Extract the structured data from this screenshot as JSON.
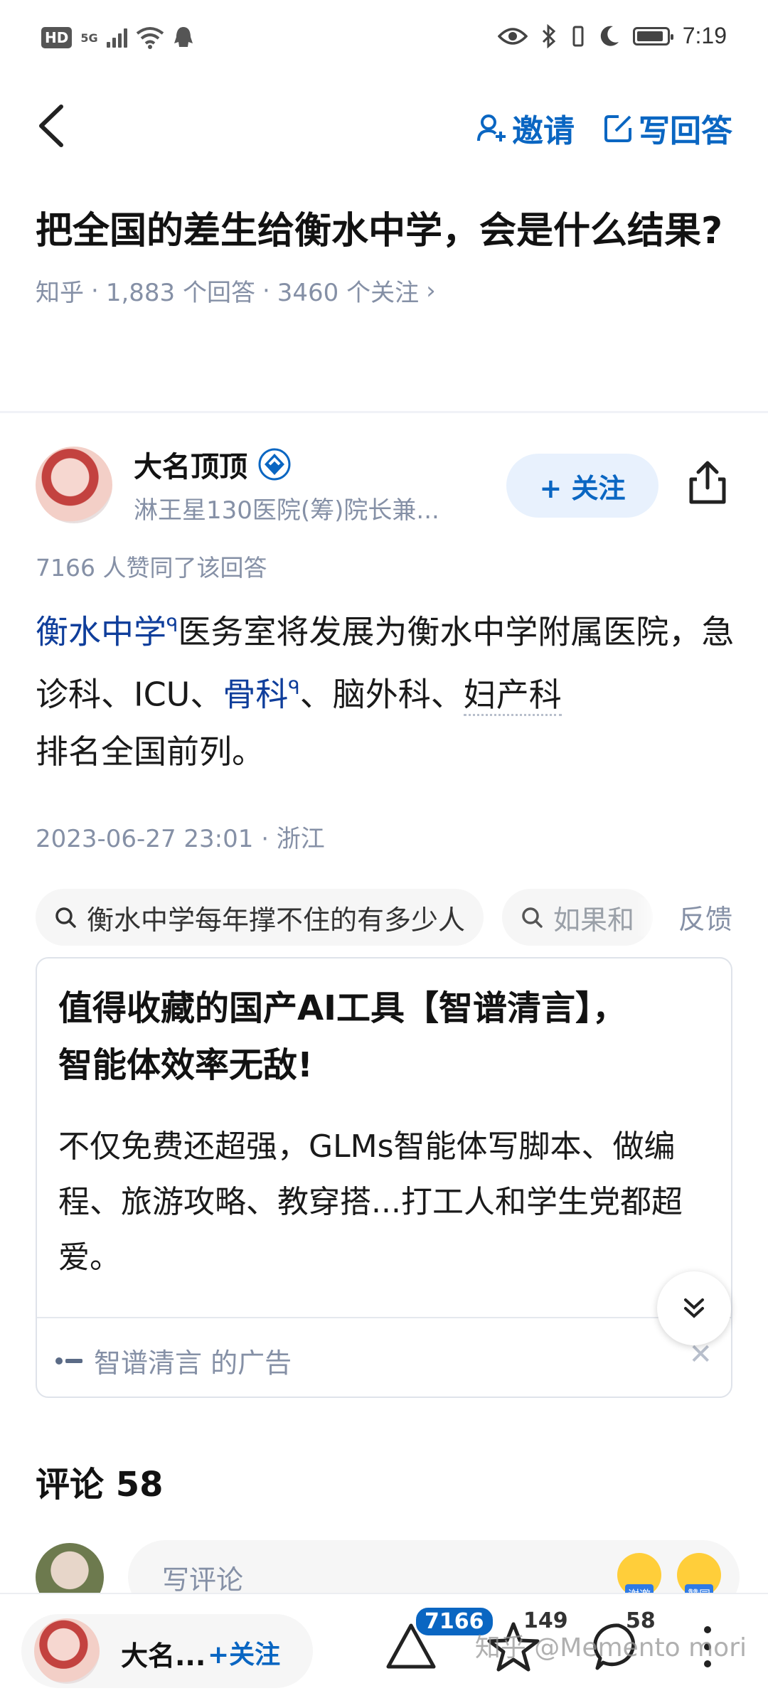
{
  "status_bar": {
    "hd": "HD",
    "network": "5G",
    "time": "7:19",
    "battery_level": 0.9
  },
  "nav": {
    "invite_label": "邀请",
    "write_answer_label": "写回答"
  },
  "question": {
    "title": "把全国的差生给衡水中学，会是什么结果?",
    "source": "知乎",
    "answers": "1,883 个回答",
    "followers": "3460 个关注",
    "sep": "·",
    "more": "›"
  },
  "author": {
    "name": "大名顶顶",
    "description": "淋王星130医院(筹)院长兼...",
    "follow_label": "+ 关注"
  },
  "upvote_line": "7166 人赞同了该回答",
  "answer": {
    "link1": "衡水中学",
    "text1": "医务室将发展为衡水中学附属医院，急诊科、ICU、",
    "link2": "骨科",
    "text2": "、脑外科、",
    "text3": "妇产科",
    "text4": "排名全国前列。"
  },
  "answer_time": "2023-06-27 23:01 · 浙江",
  "related": {
    "chip1": "衡水中学每年撑不住的有多少人",
    "chip2": "如果和",
    "feedback": "反馈"
  },
  "ad": {
    "title": "值得收藏的国产AI工具【智谱清言】，智能体效率无敌!",
    "description": "不仅免费还超强，GLMs智能体写脚本、做编程、旅游攻略、教穿搭...打工人和学生党都超爱。",
    "sponsor": "智谱清言 的广告",
    "close": "✕"
  },
  "comments": {
    "title": "评论 58",
    "placeholder": "写评论",
    "emoji1": "谢邀",
    "emoji2": "赞同"
  },
  "bottom_bar": {
    "author_short": "大名...",
    "follow_label": "+关注",
    "upvotes": "7166",
    "favorites": "149",
    "comments": "58",
    "watermark": "知乎 @Memento mori"
  },
  "colors": {
    "accent": "#0a66c2",
    "link": "#0f3e9b",
    "meta": "#8590a6"
  }
}
